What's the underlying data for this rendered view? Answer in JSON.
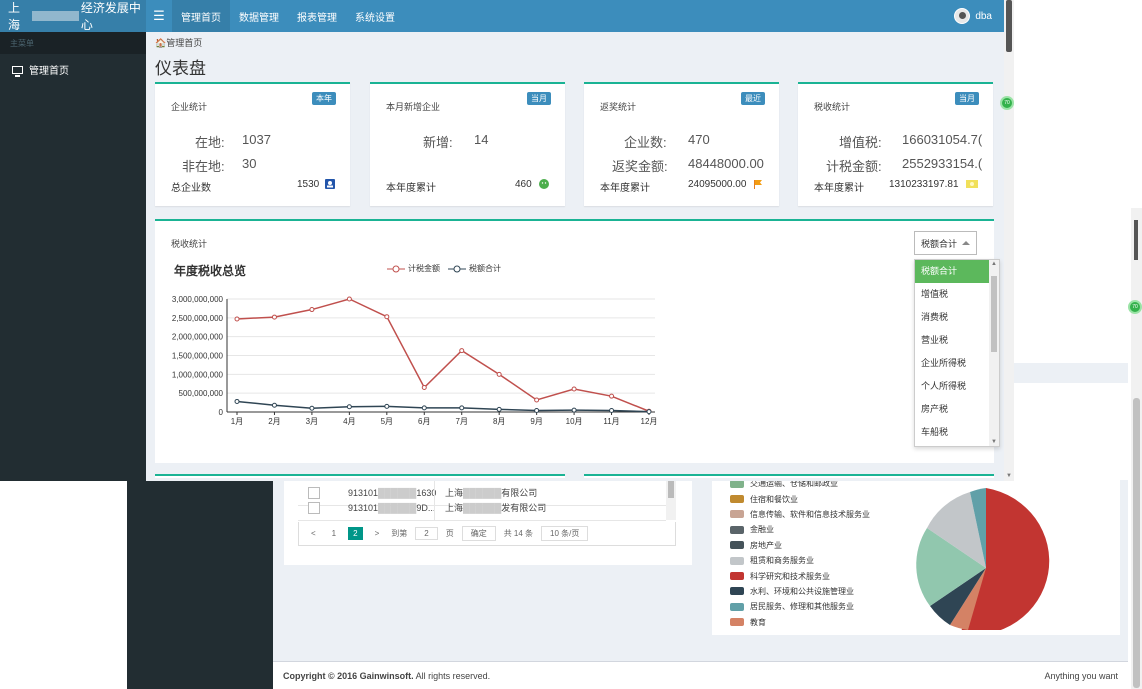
{
  "app": {
    "title_left": "上海",
    "title_right": "经济发展中心",
    "nav": [
      "管理首页",
      "数据管理",
      "报表管理",
      "系统设置"
    ],
    "user": "dba"
  },
  "sidebar": {
    "header": "主菜单",
    "items": [
      "管理首页"
    ]
  },
  "breadcrumb": "管理首页",
  "page_title": "仪表盘",
  "cards": [
    {
      "title": "企业统计",
      "badge": "本年",
      "badge_color": "#3c8dbc",
      "rows": [
        {
          "k": "在地:",
          "v": "1037"
        },
        {
          "k": "非在地:",
          "v": "30"
        }
      ],
      "total_label": "总企业数",
      "total_value": "1530",
      "icon": "user-badge-icon"
    },
    {
      "title": "本月新增企业",
      "badge": "当月",
      "badge_color": "#3c8dbc",
      "rows": [
        {
          "k": "新增:",
          "v": "14"
        }
      ],
      "total_label": "本年度累计",
      "total_value": "460",
      "icon": "smile-icon"
    },
    {
      "title": "返奖统计",
      "badge": "最近",
      "badge_color": "#3c8dbc",
      "rows": [
        {
          "k": "企业数:",
          "v": "470"
        },
        {
          "k": "返奖金额:",
          "v": "48448000.00"
        }
      ],
      "total_label": "本年度累计",
      "total_value": "24095000.00",
      "icon": "flag-icon"
    },
    {
      "title": "税收统计",
      "badge": "当月",
      "badge_color": "#3c8dbc",
      "rows": [
        {
          "k": "增值税:",
          "v": "166031054.7("
        },
        {
          "k": "计税金额:",
          "v": "2552933154.("
        }
      ],
      "total_label": "本年度累计",
      "total_value": "1310233197.81",
      "icon": "money-icon"
    }
  ],
  "tax_panel": {
    "title": "税收统计",
    "select_value": "税额合计",
    "options": [
      "税额合计",
      "增值税",
      "消费税",
      "营业税",
      "企业所得税",
      "个人所得税",
      "房产税",
      "车船税"
    ]
  },
  "chart_data": {
    "type": "line",
    "title": "年度税收总览",
    "categories": [
      "1月",
      "2月",
      "3月",
      "4月",
      "5月",
      "6月",
      "7月",
      "8月",
      "9月",
      "10月",
      "11月",
      "12月"
    ],
    "y_ticks": [
      "0",
      "500,000,000",
      "1,000,000,000",
      "1,500,000,000",
      "2,000,000,000",
      "2,500,000,000",
      "3,000,000,000"
    ],
    "ylim": [
      0,
      3000000000
    ],
    "series": [
      {
        "name": "计税金额",
        "color": "#c0504d",
        "values": [
          2470000000,
          2520000000,
          2720000000,
          3000000000,
          2530000000,
          650000000,
          1630000000,
          1000000000,
          320000000,
          610000000,
          420000000,
          20000000
        ]
      },
      {
        "name": "税额合计",
        "color": "#2f4554",
        "values": [
          280000000,
          180000000,
          100000000,
          140000000,
          150000000,
          110000000,
          110000000,
          70000000,
          40000000,
          50000000,
          40000000,
          10000000
        ]
      }
    ]
  },
  "bg": {
    "rows": [
      {
        "id": "913101",
        "id_tail": "1630",
        "name": "上海",
        "name_tail": "有限公司"
      },
      {
        "id": "913101",
        "id_tail": "9D...",
        "name": "上海",
        "name_tail": "发有限公司"
      }
    ],
    "pager": {
      "prev": "<",
      "p1": "1",
      "p2": "2",
      "next": ">",
      "goto": "到第",
      "page_val": "2",
      "page_unit": "页",
      "ok": "确定",
      "total": "共 14 条",
      "size": "10 条/页"
    },
    "pie_legend": [
      {
        "label": "交通运输、仓储和邮政业",
        "color": "#7fb28a"
      },
      {
        "label": "住宿和餐饮业",
        "color": "#c08a2f"
      },
      {
        "label": "信息传输、软件和信息技术服务业",
        "color": "#c8a494"
      },
      {
        "label": "金融业",
        "color": "#5a6469"
      },
      {
        "label": "房地产业",
        "color": "#45535a"
      },
      {
        "label": "租赁和商务服务业",
        "color": "#c2c6c9"
      },
      {
        "label": "科学研究和技术服务业",
        "color": "#c23531"
      },
      {
        "label": "水利、环境和公共设施管理业",
        "color": "#2f4554"
      },
      {
        "label": "居民服务、修理和其他服务业",
        "color": "#61a0a8"
      },
      {
        "label": "教育",
        "color": "#d48265"
      }
    ],
    "footer_left": "Copyright © 2016 Gainwinsoft.",
    "footer_left2": " All rights reserved.",
    "footer_right": "Anything you want"
  }
}
